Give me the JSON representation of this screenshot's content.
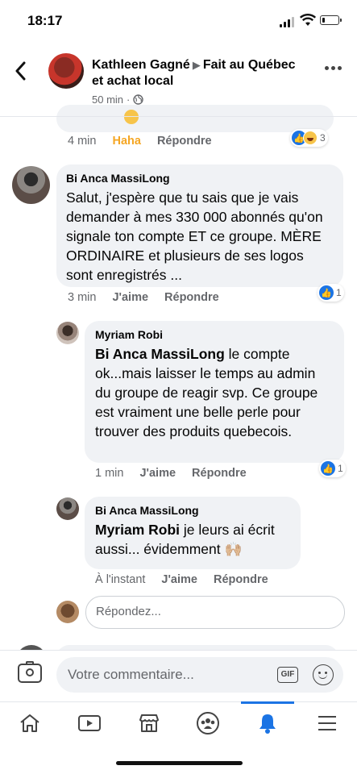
{
  "status_bar": {
    "time": "18:17"
  },
  "header": {
    "name": "Kathleen Gagné",
    "group": "Fait au Québec et achat local",
    "meta_time": "50 min",
    "meta_separator": "·"
  },
  "top_comment": {
    "time": "4 min",
    "reaction_label": "Haha",
    "reply_label": "Répondre",
    "reaction_count": "3"
  },
  "comments": [
    {
      "author": "Bi Anca MassiLong",
      "text": "Salut, j'espère que tu sais que je vais demander à mes 330 000 abonnés qu'on signale ton compte ET ce groupe. MÈRE ORDINAIRE et plusieurs de ses logos sont enregistrés ...",
      "time": "3 min",
      "like_label": "J'aime",
      "reply_label": "Répondre",
      "reaction_count": "1"
    },
    {
      "author": "Myriam Robi",
      "mention": "Bi Anca MassiLong",
      "text": " le compte ok...mais laisser le temps au admin du groupe de reagir svp. Ce groupe est vraiment une belle perle pour trouver des produits quebecois.",
      "time": "1 min",
      "like_label": "J'aime",
      "reply_label": "Répondre",
      "reaction_count": "1"
    },
    {
      "author": "Bi Anca MassiLong",
      "mention": "Myriam Robi",
      "text": " je leurs ai écrit aussi... évidemment 🙌🏼",
      "time": "À l'instant",
      "like_label": "J'aime",
      "reply_label": "Répondre"
    }
  ],
  "reply_input": {
    "placeholder": "Répondez..."
  },
  "composer": {
    "placeholder": "Votre commentaire...",
    "gif_label": "GIF"
  },
  "tabs": [
    {
      "name": "home-icon"
    },
    {
      "name": "watch-icon"
    },
    {
      "name": "marketplace-icon"
    },
    {
      "name": "groups-icon"
    },
    {
      "name": "notifications-icon",
      "active": true
    },
    {
      "name": "menu-icon"
    }
  ],
  "colors": {
    "accent": "#1b74e4",
    "haha": "#f5a623",
    "bubble": "#f0f2f5",
    "muted": "#65676b"
  }
}
